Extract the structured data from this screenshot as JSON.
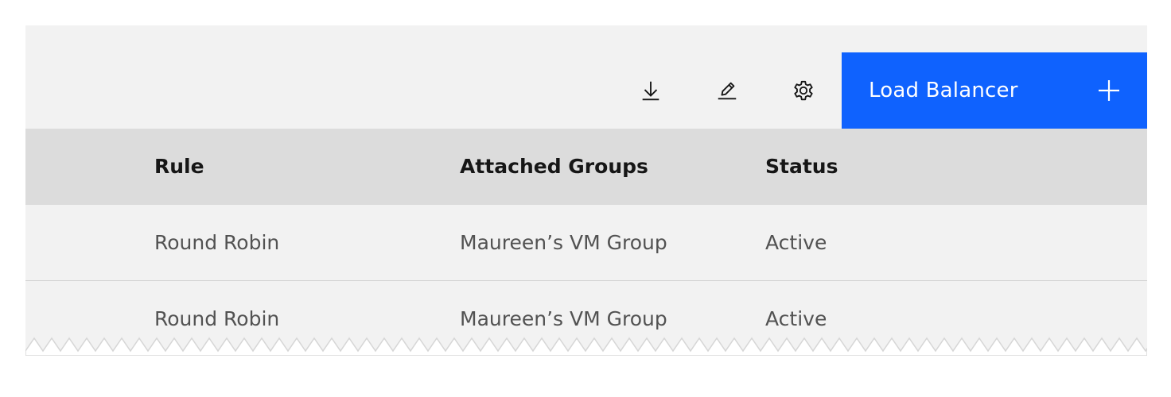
{
  "toolbar": {
    "download_icon": "download-icon",
    "edit_icon": "edit-pencil-icon",
    "settings_icon": "gear-icon",
    "primary_button_label": "Load Balancer",
    "primary_button_icon": "plus-icon"
  },
  "table": {
    "columns": [
      "Rule",
      "Attached Groups",
      "Status"
    ],
    "rows": [
      [
        "Round Robin",
        "Maureen’s VM Group",
        "Active"
      ],
      [
        "Round Robin",
        "Maureen’s VM Group",
        "Active"
      ]
    ]
  },
  "colors": {
    "primary": "#0f62fe",
    "background": "#f2f2f2",
    "header_background": "#dcdcdc"
  }
}
